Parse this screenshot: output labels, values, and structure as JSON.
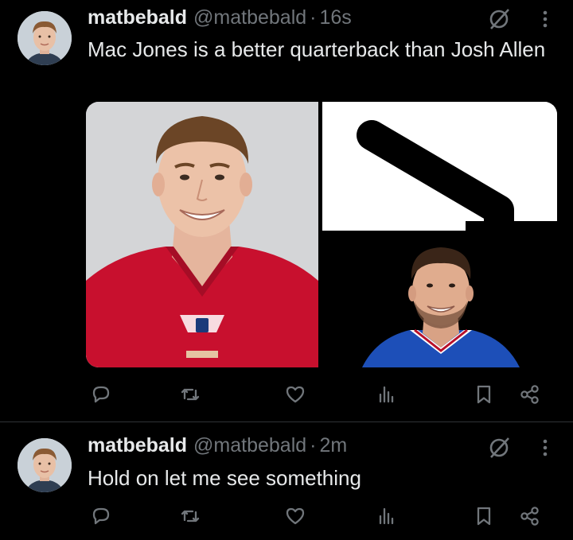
{
  "tweets": [
    {
      "display_name": "matbebald",
      "handle": "@matbebald",
      "separator": "·",
      "time": "16s",
      "text": "Mac Jones is a better quarterback than Josh Allen",
      "media": {
        "left_image": "player-photo-red-49ers-jersey",
        "right_top_image": "black-arrow-on-white",
        "right_bottom_image": "player-photo-blue-jersey"
      }
    },
    {
      "display_name": "matbebald",
      "handle": "@matbebald",
      "separator": "·",
      "time": "2m",
      "text": "Hold on let me see something"
    }
  ],
  "icons": [
    "grok-icon",
    "more-icon",
    "reply-icon",
    "retweet-icon",
    "like-icon",
    "views-icon",
    "bookmark-icon",
    "share-icon"
  ],
  "colors": {
    "background": "#000000",
    "primary_text": "#e7e9ea",
    "secondary_text": "#71767b",
    "divider": "#2f3336",
    "jersey_red": "#c8102e",
    "jersey_blue": "#1d4fb8"
  }
}
